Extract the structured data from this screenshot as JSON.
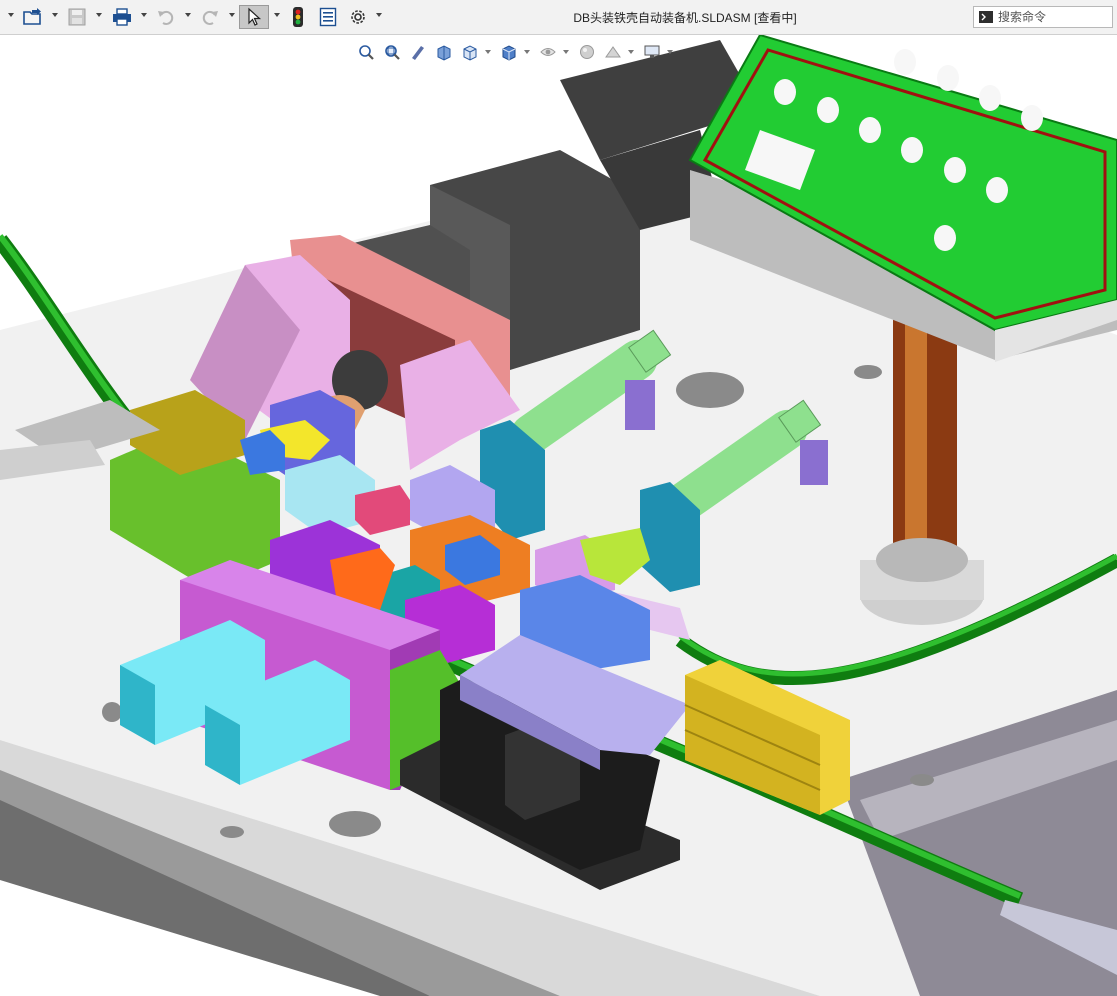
{
  "window": {
    "title": "DB头装铁壳自动装备机.SLDASM [查看中]"
  },
  "toolbar": {
    "icons": [
      "open-icon",
      "save-icon",
      "print-icon",
      "undo-icon",
      "redo-icon",
      "select-icon",
      "traffic-light-icon",
      "file-properties-icon",
      "options-icon"
    ],
    "active": "select-icon"
  },
  "search": {
    "placeholder": "搜索命令"
  },
  "heads_up": {
    "icons": [
      "zoom-to-fit-icon",
      "zoom-area-icon",
      "previous-view-icon",
      "section-view-icon",
      "view-orientation-icon",
      "display-style-icon",
      "hide-show-icon",
      "edit-appearance-icon",
      "scene-icon",
      "view-settings-icon"
    ]
  },
  "colors": {
    "toolbar_bg": "#f2f2f2",
    "active_button": "#c7c7c7",
    "viewport_bg": "#ffffff",
    "green_rail": "#1aa11a",
    "magenta_block": "#c65ad1",
    "cyan_cylinder": "#3fd3e6",
    "yellow_slide": "#f0d23a",
    "pcb_green": "#22cc33"
  }
}
